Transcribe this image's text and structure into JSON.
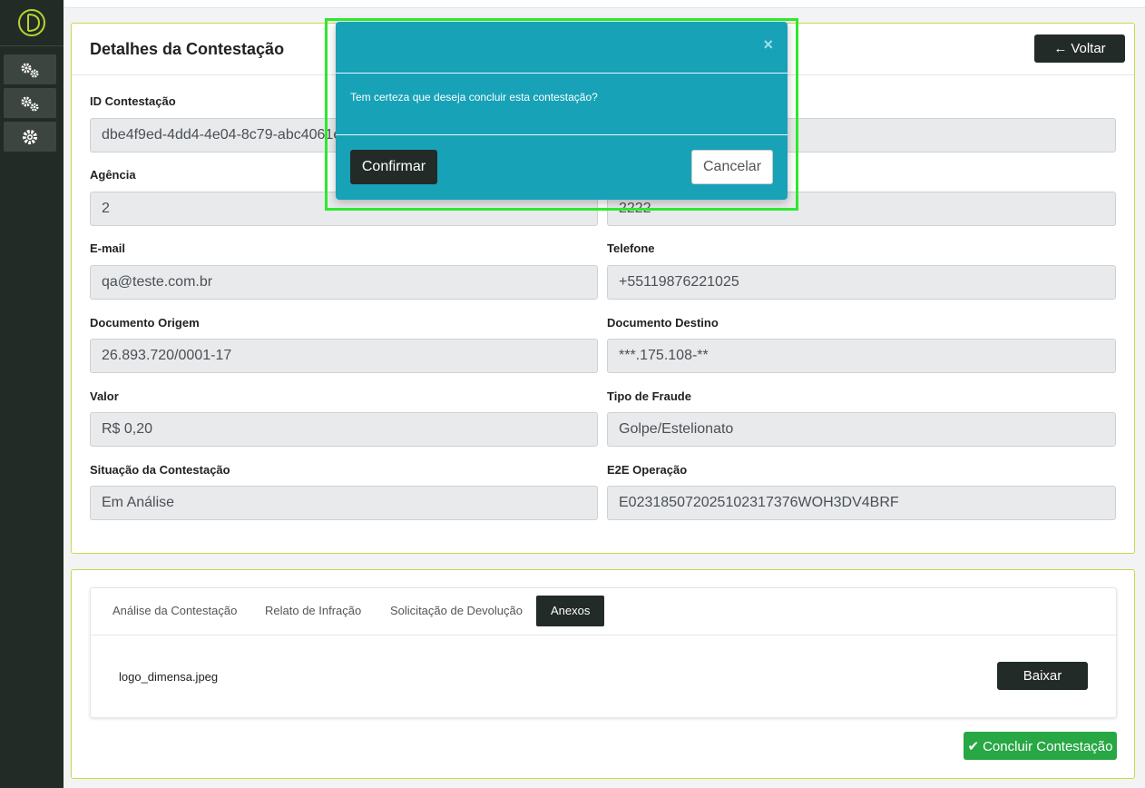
{
  "page": {
    "title": "Detalhes da Contestação",
    "back_label": "Voltar"
  },
  "fields": {
    "id_label": "ID Contestação",
    "id_value": "dbe4f9ed-4dd4-4e04-8c79-abc4061e",
    "agencia_label": "Agência",
    "agencia_value": "2",
    "conta_value": "2222",
    "email_label": "E-mail",
    "email_value": "qa@teste.com.br",
    "telefone_label": "Telefone",
    "telefone_value": "+55119876221025",
    "doc_origem_label": "Documento Origem",
    "doc_origem_value": "26.893.720/0001-17",
    "doc_destino_label": "Documento Destino",
    "doc_destino_value": "***.175.108-**",
    "valor_label": "Valor",
    "valor_value": "R$ 0,20",
    "tipo_fraude_label": "Tipo de Fraude",
    "tipo_fraude_value": "Golpe/Estelionato",
    "situacao_label": "Situação da Contestação",
    "situacao_value": "Em Análise",
    "e2e_label": "E2E Operação",
    "e2e_value": "E02318507202510231737​6WOH3DV4BRF"
  },
  "tabs": [
    {
      "label": "Análise da Contestação"
    },
    {
      "label": "Relato de Infração"
    },
    {
      "label": "Solicitação de Devolução"
    },
    {
      "label": "Anexos"
    }
  ],
  "attachments": {
    "file_name": "logo_dimensa.jpeg",
    "download_label": "Baixar"
  },
  "conclude_label": "Concluir Contestação",
  "modal": {
    "close_glyph": "×",
    "message": "Tem certeza que deseja concluir esta contestação?",
    "confirm_label": "Confirmar",
    "cancel_label": "Cancelar"
  },
  "colors": {
    "sidebar": "#232b27",
    "accent_border": "#c9d94a",
    "modal_bg": "#17a2b8",
    "success": "#28a745",
    "dark_button": "#222b27",
    "highlight": "#2ee82e"
  },
  "icons": {
    "logo": "logo-icon",
    "sidebar": [
      "gears-icon",
      "gears-icon",
      "gear-icon"
    ],
    "back": "arrow-left-icon",
    "conclude": "check-icon",
    "close": "close-icon"
  }
}
